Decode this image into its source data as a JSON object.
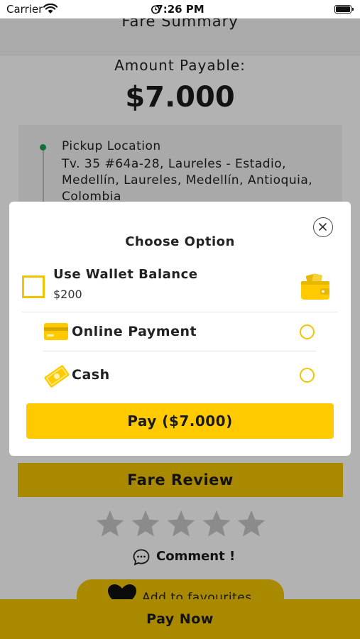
{
  "status_bar": {
    "carrier": "Carrier",
    "time": "7:26 PM"
  },
  "header": {
    "title": "Fare Summary"
  },
  "summary": {
    "amount_label": "Amount Payable:",
    "amount_value": "$7.000"
  },
  "location": {
    "title": "Pickup Location",
    "address": "Tv. 35 #64a-28, Laureles - Estadio, Medellín, Laureles, Medellín, Antioquia, Colombia"
  },
  "modal": {
    "heading": "Choose Option",
    "wallet": {
      "label": "Use Wallet Balance",
      "amount": "$200",
      "checked": false
    },
    "options": [
      {
        "label": "Online Payment",
        "icon": "credit-card-icon",
        "selected": false
      },
      {
        "label": "Cash",
        "icon": "cash-icon",
        "selected": false
      }
    ],
    "pay_button_label": "Pay ($7.000)"
  },
  "fare_review": {
    "label": "Fare Review"
  },
  "rating": {
    "max": 5,
    "value": 0
  },
  "comment": {
    "label": "Comment !"
  },
  "favourites": {
    "label": "Add to favourites"
  },
  "pay_now": {
    "label": "Pay Now"
  },
  "colors": {
    "accent": "#ffcb00",
    "accent_dimmed": "#f2c400",
    "pickup_dot": "#1d9e55",
    "text": "#222222"
  }
}
